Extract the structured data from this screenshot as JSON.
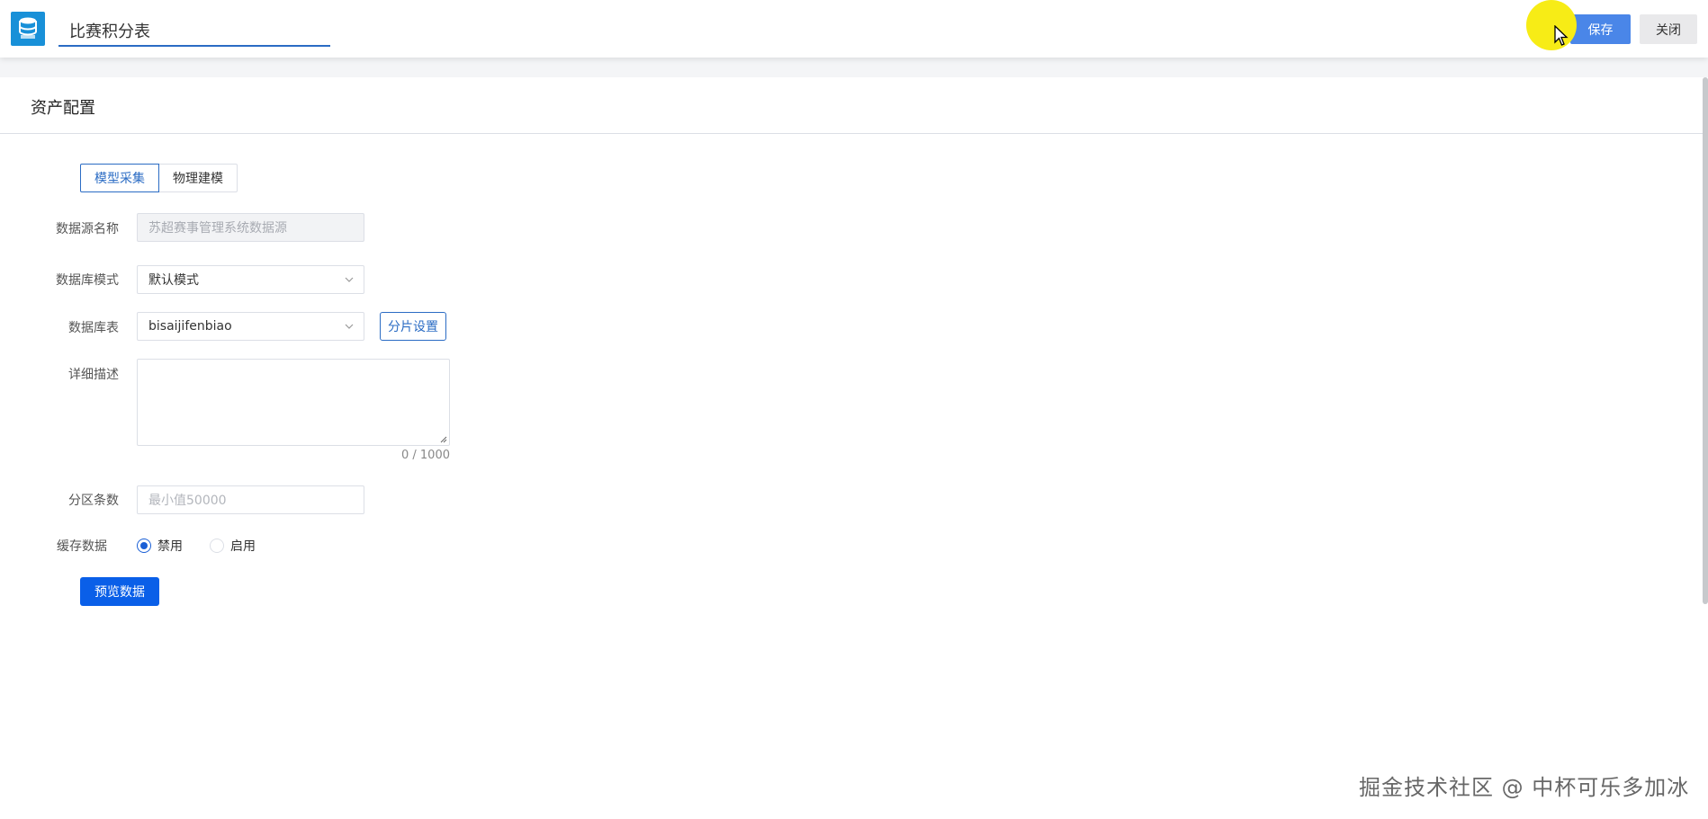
{
  "header": {
    "title_value": "比赛积分表",
    "save_label": "保存",
    "close_label": "关闭"
  },
  "panel": {
    "title": "资产配置",
    "tabs": [
      {
        "label": "模型采集",
        "active": true
      },
      {
        "label": "物理建模",
        "active": false
      }
    ]
  },
  "form": {
    "datasource": {
      "label": "数据源名称",
      "placeholder": "苏超赛事管理系统数据源"
    },
    "schema": {
      "label": "数据库模式",
      "value": "默认模式"
    },
    "table": {
      "label": "数据库表",
      "value": "bisaijifenbiao",
      "shard_button": "分片设置"
    },
    "description": {
      "label": "详细描述",
      "value": "",
      "counter": "0 / 1000"
    },
    "partition": {
      "label": "分区条数",
      "placeholder": "最小值50000"
    },
    "cache": {
      "label": "缓存数据",
      "options": [
        "禁用",
        "启用"
      ],
      "selected": "禁用"
    },
    "preview_button": "预览数据"
  },
  "watermark": "掘金技术社区 @ 中杯可乐多加冰",
  "colors": {
    "primary": "#0a5fe8",
    "accent": "#2b6cc4",
    "save": "#4a86e8",
    "cursor_highlight": "#f7ec16"
  }
}
